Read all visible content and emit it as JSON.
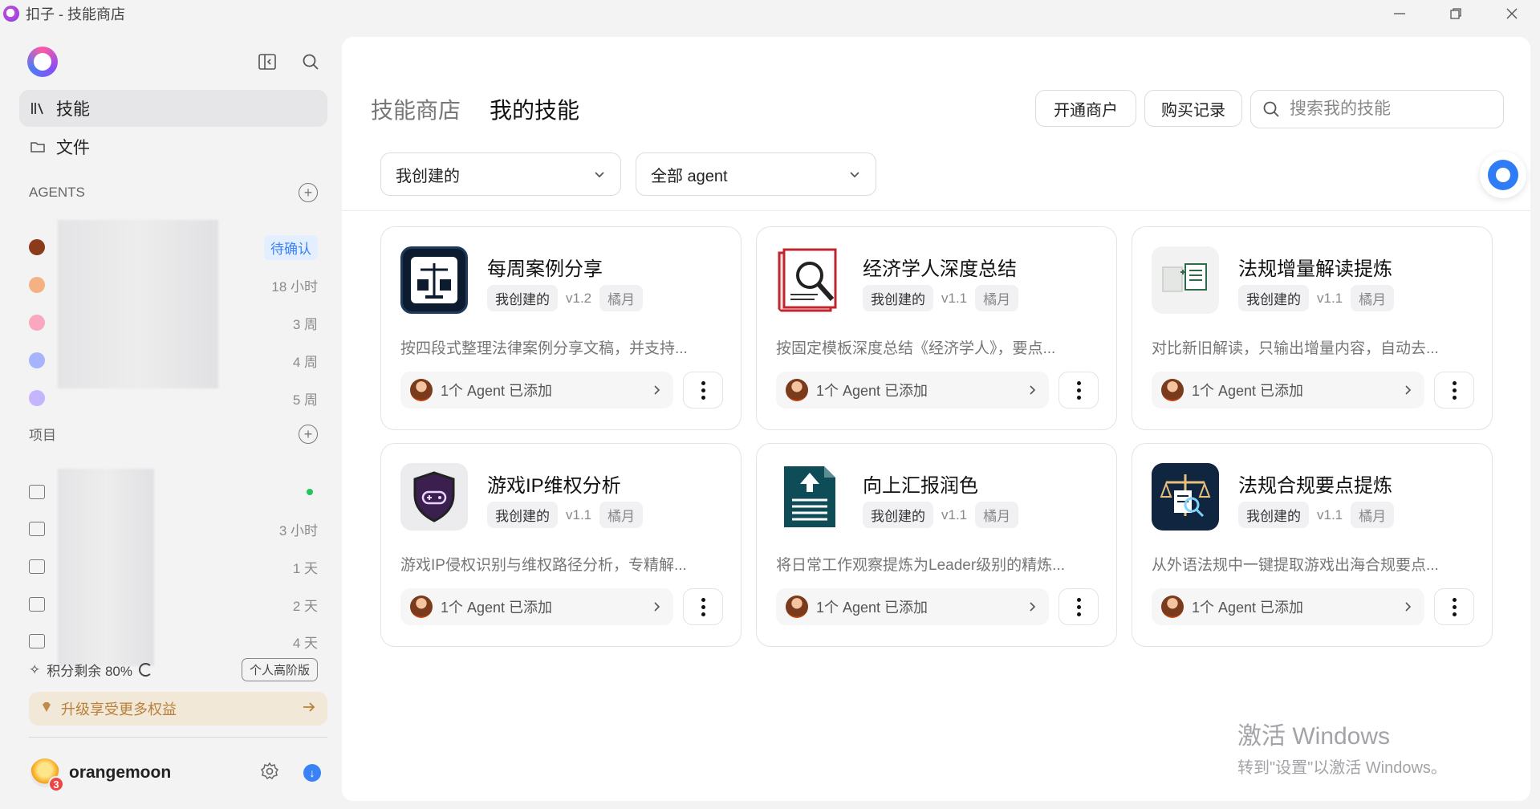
{
  "window": {
    "title": "扣子 - 技能商店"
  },
  "sidebar": {
    "nav": [
      {
        "label": "技能",
        "icon": "library-icon",
        "active": true
      },
      {
        "label": "文件",
        "icon": "folder-icon",
        "active": false
      }
    ],
    "agents_heading": "AGENTS",
    "agents": [
      {
        "name": "",
        "meta": "待确认",
        "badge": true,
        "color": "#8b3a1a"
      },
      {
        "name": "",
        "meta": "18 小时",
        "badge": false,
        "color": "#f4b183"
      },
      {
        "name": "",
        "meta": "3 周",
        "badge": false,
        "color": "#f9a8c0"
      },
      {
        "name": "",
        "meta": "4 周",
        "badge": false,
        "color": "#a5b4fc"
      },
      {
        "name": "",
        "meta": "5 周",
        "badge": false,
        "color": "#c4b5fd"
      }
    ],
    "projects_heading": "项目",
    "projects": [
      {
        "meta": "",
        "status_dot": true
      },
      {
        "meta": "3 小时"
      },
      {
        "meta": "1 天"
      },
      {
        "meta": "2 天"
      },
      {
        "meta": "4 天"
      }
    ],
    "credits": {
      "label": "积分剩余 80%",
      "plan": "个人高阶版"
    },
    "upgrade_label": "升级享受更多权益",
    "user": {
      "name": "orangemoon",
      "notifications": "3"
    }
  },
  "main": {
    "tabs": [
      {
        "label": "技能商店",
        "active": false
      },
      {
        "label": "我的技能",
        "active": true
      }
    ],
    "buttons": {
      "merchant": "开通商户",
      "history": "购买记录"
    },
    "search": {
      "placeholder": "搜索我的技能"
    },
    "filters": {
      "creator": "我创建的",
      "agent": "全部 agent"
    },
    "cards": [
      {
        "name": "每周案例分享",
        "tag": "我创建的",
        "version": "v1.2",
        "author": "橘月",
        "desc": "按四段式整理法律案例分享文稿，并支持...",
        "agents": "1个 Agent 已添加",
        "thumb": "scales"
      },
      {
        "name": "经济学人深度总结",
        "tag": "我创建的",
        "version": "v1.1",
        "author": "橘月",
        "desc": "按固定模板深度总结《经济学人》，要点...",
        "agents": "1个 Agent 已添加",
        "thumb": "magnifier"
      },
      {
        "name": "法规增量解读提炼",
        "tag": "我创建的",
        "version": "v1.1",
        "author": "橘月",
        "desc": "对比新旧解读，只输出增量内容，自动去...",
        "agents": "1个 Agent 已添加",
        "thumb": "docs"
      },
      {
        "name": "游戏IP维权分析",
        "tag": "我创建的",
        "version": "v1.1",
        "author": "橘月",
        "desc": "游戏IP侵权识别与维权路径分析，专精解...",
        "agents": "1个 Agent 已添加",
        "thumb": "shield"
      },
      {
        "name": "向上汇报润色",
        "tag": "我创建的",
        "version": "v1.1",
        "author": "橘月",
        "desc": "将日常工作观察提炼为Leader级别的精炼...",
        "agents": "1个 Agent 已添加",
        "thumb": "upload"
      },
      {
        "name": "法规合规要点提炼",
        "tag": "我创建的",
        "version": "v1.1",
        "author": "橘月",
        "desc": "从外语法规中一键提取游戏出海合规要点...",
        "agents": "1个 Agent 已添加",
        "thumb": "scales2"
      }
    ]
  },
  "watermark": {
    "line1": "激活 Windows",
    "line2": "转到\"设置\"以激活 Windows。"
  }
}
